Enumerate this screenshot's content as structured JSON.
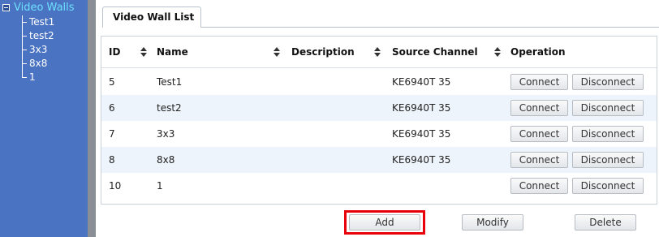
{
  "sidebar": {
    "root_label": "Video Walls",
    "items": [
      {
        "label": "Test1"
      },
      {
        "label": "test2"
      },
      {
        "label": "3x3"
      },
      {
        "label": "8x8"
      },
      {
        "label": "1"
      }
    ]
  },
  "tab": {
    "label": "Video Wall List"
  },
  "table": {
    "headers": {
      "id": "ID",
      "name": "Name",
      "description": "Description",
      "source_channel": "Source Channel",
      "operation": "Operation"
    },
    "rows": [
      {
        "id": "5",
        "name": "Test1",
        "description": "",
        "source_channel": "KE6940T 35",
        "connect": "Connect",
        "disconnect": "Disconnect"
      },
      {
        "id": "6",
        "name": "test2",
        "description": "",
        "source_channel": "KE6940T 35",
        "connect": "Connect",
        "disconnect": "Disconnect"
      },
      {
        "id": "7",
        "name": "3x3",
        "description": "",
        "source_channel": "KE6940T 35",
        "connect": "Connect",
        "disconnect": "Disconnect"
      },
      {
        "id": "8",
        "name": "8x8",
        "description": "",
        "source_channel": "KE6940T 35",
        "connect": "Connect",
        "disconnect": "Disconnect"
      },
      {
        "id": "10",
        "name": "1",
        "description": "",
        "source_channel": "",
        "connect": "Connect",
        "disconnect": "Disconnect"
      }
    ]
  },
  "actions": {
    "add": "Add",
    "modify": "Modify",
    "delete": "Delete"
  },
  "colors": {
    "sidebar_bg": "#4a73c2",
    "root_label": "#6fe0ff",
    "row_alt": "#eef4fb",
    "highlight": "#e8000b"
  },
  "icons": {
    "tree_toggle": "collapse-minus-icon",
    "sort": "sort-updown-icon"
  }
}
